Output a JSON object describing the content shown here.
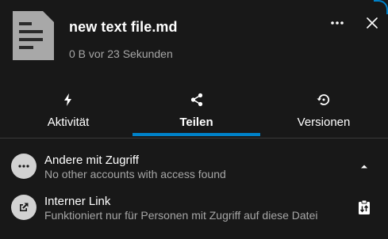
{
  "header": {
    "file_name": "new text file.md",
    "file_meta": "0 B vor 23 Sekunden",
    "thumbnail_icon": "text-document-icon",
    "more_icon": "more-horizontal-icon",
    "close_icon": "close-icon"
  },
  "tabs": [
    {
      "label": "Aktivität",
      "icon": "lightning-icon",
      "active": false
    },
    {
      "label": "Teilen",
      "icon": "share-icon",
      "active": true
    },
    {
      "label": "Versionen",
      "icon": "restore-icon",
      "active": false
    }
  ],
  "sharing": {
    "others_with_access": {
      "title": "Andere mit Zugriff",
      "subtitle": "No other accounts with access found",
      "icon": "more-horizontal-icon",
      "action_icon": "caret-up-icon"
    },
    "internal_link": {
      "title": "Interner Link",
      "subtitle": "Funktioniert nur für Personen mit Zugriff auf diese Datei",
      "icon": "open-in-new-icon",
      "action_icon": "clipboard-copy-icon"
    }
  },
  "colors": {
    "background": "#181818",
    "accent": "#0082c9",
    "secondary_text": "#a6a6a6",
    "avatar_bg": "#d2d2d2"
  }
}
